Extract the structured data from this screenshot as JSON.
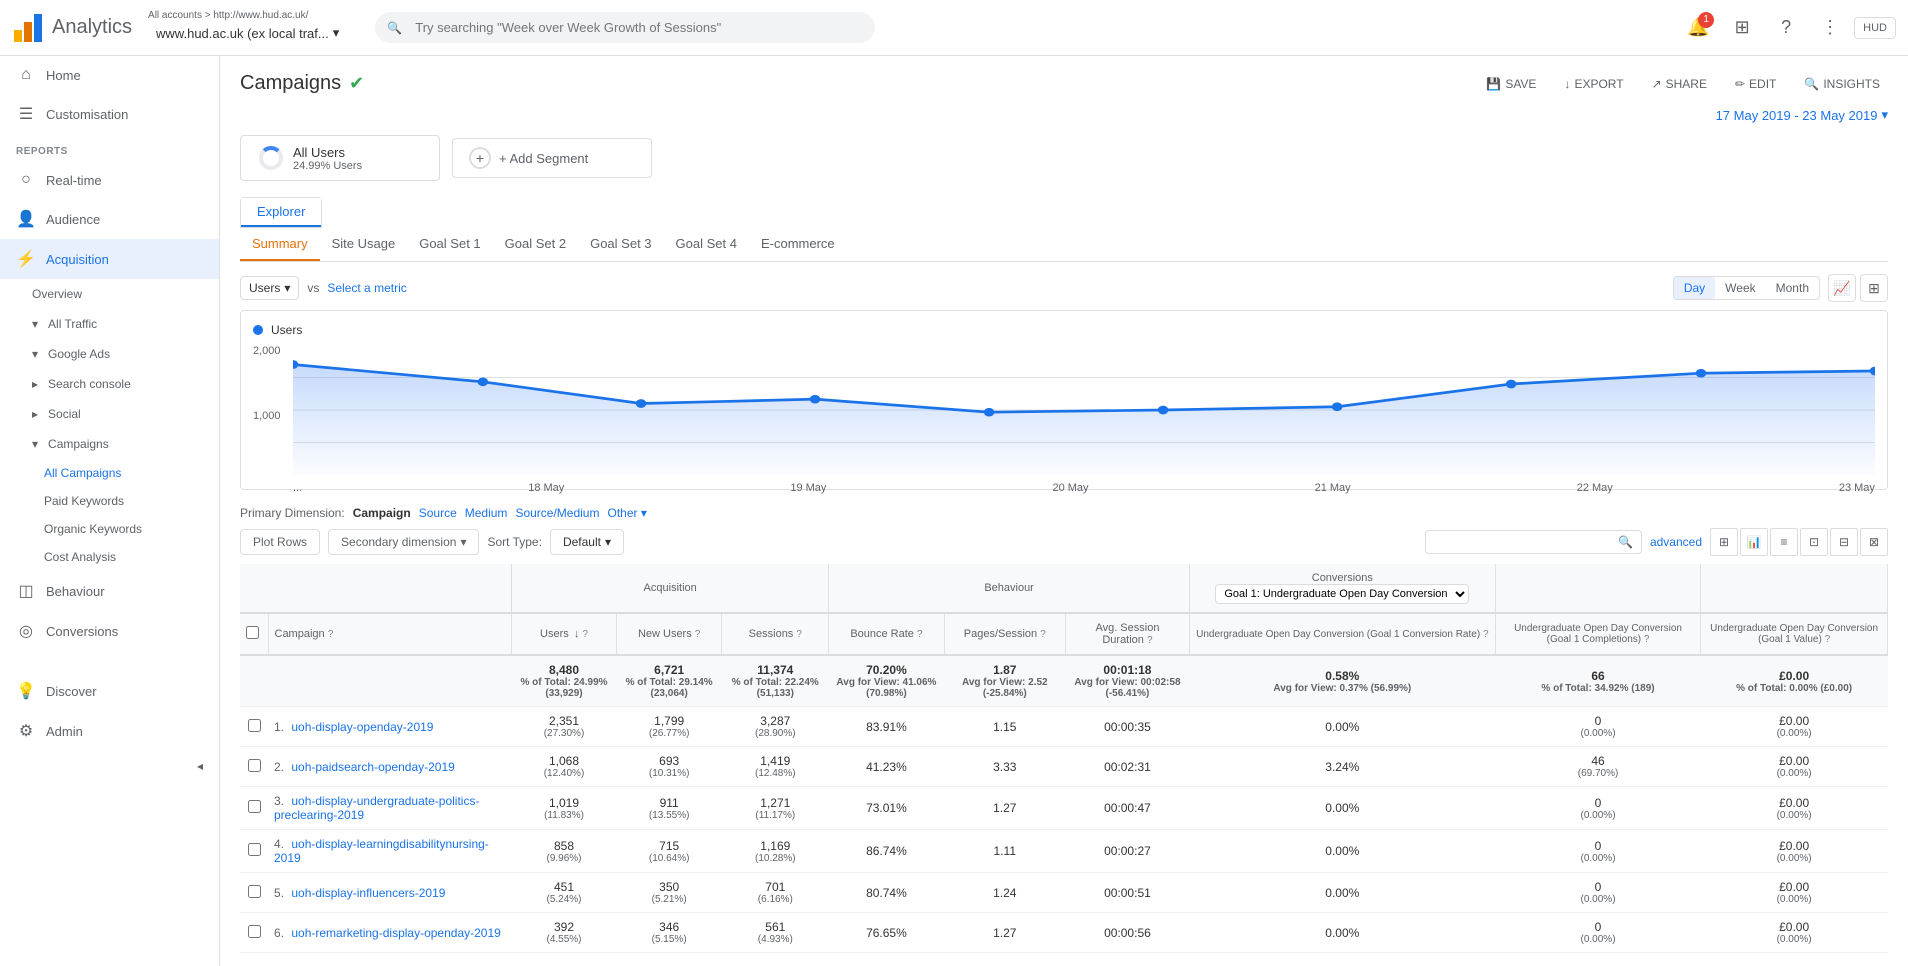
{
  "topbar": {
    "logo_text": "Analytics",
    "breadcrumb": "All accounts > http://www.hud.ac.uk/",
    "property": "www.hud.ac.uk (ex local traf...",
    "search_placeholder": "Try searching \"Week over Week Growth of Sessions\"",
    "notification_count": "1",
    "account_label": "HUD"
  },
  "sidebar": {
    "nav_items": [
      {
        "id": "home",
        "label": "Home",
        "icon": "⌂"
      },
      {
        "id": "customisation",
        "label": "Customisation",
        "icon": "☰"
      }
    ],
    "reports_label": "REPORTS",
    "report_items": [
      {
        "id": "realtime",
        "label": "Real-time",
        "icon": "○"
      },
      {
        "id": "audience",
        "label": "Audience",
        "icon": "👤"
      },
      {
        "id": "acquisition",
        "label": "Acquisition",
        "icon": "⚡",
        "active": true
      },
      {
        "id": "behaviour",
        "label": "Behaviour",
        "icon": "◫"
      },
      {
        "id": "conversions",
        "label": "Conversions",
        "icon": "◎"
      }
    ],
    "acquisition_sub": [
      {
        "id": "overview",
        "label": "Overview"
      },
      {
        "id": "all-traffic",
        "label": "All Traffic",
        "expanded": true
      },
      {
        "id": "google-ads",
        "label": "Google Ads",
        "expanded": true
      },
      {
        "id": "search-console",
        "label": "Search console"
      },
      {
        "id": "social",
        "label": "Social"
      },
      {
        "id": "campaigns",
        "label": "Campaigns",
        "expanded": true,
        "active": true
      }
    ],
    "campaigns_sub": [
      {
        "id": "all-campaigns",
        "label": "All Campaigns",
        "active": true
      },
      {
        "id": "paid-keywords",
        "label": "Paid Keywords"
      },
      {
        "id": "organic-keywords",
        "label": "Organic Keywords"
      },
      {
        "id": "cost-analysis",
        "label": "Cost Analysis"
      }
    ],
    "bottom_items": [
      {
        "id": "discover",
        "label": "Discover",
        "icon": "💡"
      },
      {
        "id": "admin",
        "label": "Admin",
        "icon": "⚙"
      }
    ]
  },
  "page": {
    "title": "Campaigns",
    "verified": true
  },
  "date_range": "17 May 2019 - 23 May 2019",
  "header_actions": {
    "save": "SAVE",
    "export": "EXPORT",
    "share": "SHARE",
    "edit": "EDIT",
    "insights": "INSIGHTS"
  },
  "segment": {
    "all_users_label": "All Users",
    "all_users_pct": "24.99% Users",
    "add_segment": "+ Add Segment"
  },
  "explorer_tab": "Explorer",
  "sub_tabs": [
    "Summary",
    "Site Usage",
    "Goal Set 1",
    "Goal Set 2",
    "Goal Set 3",
    "Goal Set 4",
    "E-commerce"
  ],
  "active_sub_tab": "Summary",
  "chart": {
    "metric_label": "Users",
    "vs_label": "vs",
    "select_metric": "Select a metric",
    "legend_label": "Users",
    "time_buttons": [
      "Day",
      "Week",
      "Month"
    ],
    "active_time": "Day",
    "y_labels": [
      "2,000",
      "1,000"
    ],
    "x_labels": [
      "18 May",
      "19 May",
      "20 May",
      "21 May",
      "22 May",
      "23 May"
    ],
    "data_points": [
      {
        "x": 0,
        "y": 0.15
      },
      {
        "x": 0.12,
        "y": 0.28
      },
      {
        "x": 0.22,
        "y": 0.45
      },
      {
        "x": 0.33,
        "y": 0.42
      },
      {
        "x": 0.44,
        "y": 0.52
      },
      {
        "x": 0.55,
        "y": 0.5
      },
      {
        "x": 0.66,
        "y": 0.48
      },
      {
        "x": 0.78,
        "y": 0.3
      },
      {
        "x": 0.89,
        "y": 0.22
      },
      {
        "x": 1.0,
        "y": 0.2
      }
    ]
  },
  "primary_dimension": {
    "label": "Primary Dimension:",
    "options": [
      "Campaign",
      "Source",
      "Medium",
      "Source/Medium",
      "Other"
    ]
  },
  "table_controls": {
    "plot_rows": "Plot Rows",
    "secondary_dim": "Secondary dimension",
    "sort_type_label": "Sort Type:",
    "sort_default": "Default",
    "advanced": "advanced"
  },
  "conversion_dropdown": "Goal 1: Undergraduate Open Day Conversion",
  "table": {
    "headers": {
      "campaign": "Campaign",
      "acquisition_label": "Acquisition",
      "behaviour_label": "Behaviour",
      "conversions_label": "Conversions",
      "users": "Users",
      "new_users": "New Users",
      "sessions": "Sessions",
      "bounce_rate": "Bounce Rate",
      "pages_session": "Pages/Session",
      "avg_session": "Avg. Session Duration",
      "conv_rate": "Undergraduate Open Day Conversion (Goal 1 Conversion Rate)",
      "completions": "Undergraduate Open Day Conversion (Goal 1 Completions)",
      "value": "Undergraduate Open Day Conversion (Goal 1 Value)"
    },
    "totals": {
      "users": "8,480",
      "users_pct": "% of Total: 24.99% (33,929)",
      "new_users": "6,721",
      "new_users_pct": "% of Total: 29.14% (23,064)",
      "sessions": "11,374",
      "sessions_pct": "% of Total: 22.24% (51,133)",
      "bounce_rate": "70.20%",
      "bounce_avg": "Avg for View: 41.06% (70.98%)",
      "pages_session": "1.87",
      "pages_avg": "Avg for View: 2.52 (-25.84%)",
      "avg_session": "00:01:18",
      "avg_session_view": "Avg for View: 00:02:58 (-56.41%)",
      "conv_rate": "0.58%",
      "conv_rate_avg": "Avg for View: 0.37% (56.99%)",
      "completions": "66",
      "completions_pct": "% of Total: 34.92% (189)",
      "value": "£0.00",
      "value_pct": "% of Total: 0.00% (£0.00)"
    },
    "rows": [
      {
        "num": "1.",
        "campaign": "uoh-display-openday-2019",
        "users": "2,351",
        "users_pct": "(27.30%)",
        "new_users": "1,799",
        "new_users_pct": "(26.77%)",
        "sessions": "3,287",
        "sessions_pct": "(28.90%)",
        "bounce_rate": "83.91%",
        "pages_session": "1.15",
        "avg_session": "00:00:35",
        "conv_rate": "0.00%",
        "completions": "0",
        "completions_pct": "(0.00%)",
        "value": "£0.00",
        "value_pct": "(0.00%)"
      },
      {
        "num": "2.",
        "campaign": "uoh-paidsearch-openday-2019",
        "users": "1,068",
        "users_pct": "(12.40%)",
        "new_users": "693",
        "new_users_pct": "(10.31%)",
        "sessions": "1,419",
        "sessions_pct": "(12.48%)",
        "bounce_rate": "41.23%",
        "pages_session": "3.33",
        "avg_session": "00:02:31",
        "conv_rate": "3.24%",
        "completions": "46",
        "completions_pct": "(69.70%)",
        "value": "£0.00",
        "value_pct": "(0.00%)"
      },
      {
        "num": "3.",
        "campaign": "uoh-display-undergraduate-politics-preclearing-2019",
        "users": "1,019",
        "users_pct": "(11.83%)",
        "new_users": "911",
        "new_users_pct": "(13.55%)",
        "sessions": "1,271",
        "sessions_pct": "(11.17%)",
        "bounce_rate": "73.01%",
        "pages_session": "1.27",
        "avg_session": "00:00:47",
        "conv_rate": "0.00%",
        "completions": "0",
        "completions_pct": "(0.00%)",
        "value": "£0.00",
        "value_pct": "(0.00%)"
      },
      {
        "num": "4.",
        "campaign": "uoh-display-learningdisabilitynursing-2019",
        "users": "858",
        "users_pct": "(9.96%)",
        "new_users": "715",
        "new_users_pct": "(10.64%)",
        "sessions": "1,169",
        "sessions_pct": "(10.28%)",
        "bounce_rate": "86.74%",
        "pages_session": "1.11",
        "avg_session": "00:00:27",
        "conv_rate": "0.00%",
        "completions": "0",
        "completions_pct": "(0.00%)",
        "value": "£0.00",
        "value_pct": "(0.00%)"
      },
      {
        "num": "5.",
        "campaign": "uoh-display-influencers-2019",
        "users": "451",
        "users_pct": "(5.24%)",
        "new_users": "350",
        "new_users_pct": "(5.21%)",
        "sessions": "701",
        "sessions_pct": "(6.16%)",
        "bounce_rate": "80.74%",
        "pages_session": "1.24",
        "avg_session": "00:00:51",
        "conv_rate": "0.00%",
        "completions": "0",
        "completions_pct": "(0.00%)",
        "value": "£0.00",
        "value_pct": "(0.00%)"
      },
      {
        "num": "6.",
        "campaign": "uoh-remarketing-display-openday-2019",
        "users": "392",
        "users_pct": "(4.55%)",
        "new_users": "346",
        "new_users_pct": "(5.15%)",
        "sessions": "561",
        "sessions_pct": "(4.93%)",
        "bounce_rate": "76.65%",
        "pages_session": "1.27",
        "avg_session": "00:00:56",
        "conv_rate": "0.00%",
        "completions": "0",
        "completions_pct": "(0.00%)",
        "value": "£0.00",
        "value_pct": "(0.00%)"
      }
    ]
  }
}
